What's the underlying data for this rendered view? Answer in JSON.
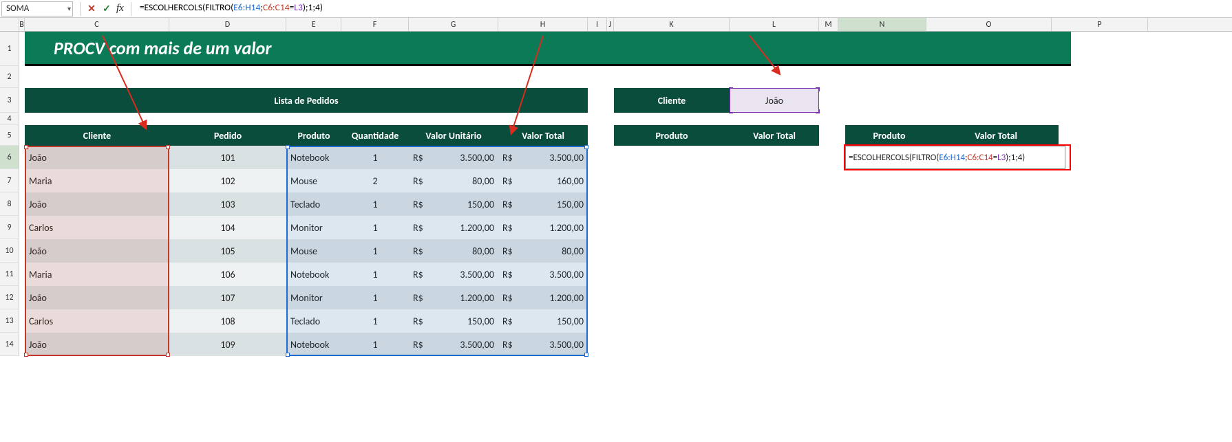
{
  "formula_bar": {
    "name_box": "SOMA",
    "fx_label": "fx",
    "formula_plain": "=ESCOLHERCOLS(FILTRO(E6:H14;C6:C14=L3);1;4)",
    "formula_parts": {
      "a": "=ESCOLHERCOLS(FILTRO(",
      "ref1": "E6:H14",
      "b": ";",
      "ref2": "C6:C14",
      "c": "=",
      "ref3": "L3",
      "d": ");1;4)"
    }
  },
  "columns": [
    "B",
    "C",
    "D",
    "E",
    "F",
    "G",
    "H",
    "I",
    "J",
    "K",
    "L",
    "M",
    "N",
    "O",
    "P"
  ],
  "rows": [
    "1",
    "2",
    "3",
    "4",
    "5",
    "6",
    "7",
    "8",
    "9",
    "10",
    "11",
    "12",
    "13",
    "14"
  ],
  "title": "PROCV com mais de um valor",
  "section_header": "Lista de Pedidos",
  "main_headers": {
    "cliente": "Cliente",
    "pedido": "Pedido",
    "produto": "Produto",
    "quantidade": "Quantidade",
    "valor_unitario": "Valor Unitário",
    "valor_total": "Valor Total"
  },
  "currency_label": "R$",
  "table": [
    {
      "cliente": "João",
      "pedido": "101",
      "produto": "Notebook",
      "quantidade": "1",
      "vu": "3.500,00",
      "vt": "3.500,00"
    },
    {
      "cliente": "Maria",
      "pedido": "102",
      "produto": "Mouse",
      "quantidade": "2",
      "vu": "80,00",
      "vt": "160,00"
    },
    {
      "cliente": "João",
      "pedido": "103",
      "produto": "Teclado",
      "quantidade": "1",
      "vu": "150,00",
      "vt": "150,00"
    },
    {
      "cliente": "Carlos",
      "pedido": "104",
      "produto": "Monitor",
      "quantidade": "1",
      "vu": "1.200,00",
      "vt": "1.200,00"
    },
    {
      "cliente": "João",
      "pedido": "105",
      "produto": "Mouse",
      "quantidade": "1",
      "vu": "80,00",
      "vt": "80,00"
    },
    {
      "cliente": "Maria",
      "pedido": "106",
      "produto": "Notebook",
      "quantidade": "1",
      "vu": "3.500,00",
      "vt": "3.500,00"
    },
    {
      "cliente": "João",
      "pedido": "107",
      "produto": "Monitor",
      "quantidade": "1",
      "vu": "1.200,00",
      "vt": "1.200,00"
    },
    {
      "cliente": "Carlos",
      "pedido": "108",
      "produto": "Teclado",
      "quantidade": "1",
      "vu": "150,00",
      "vt": "150,00"
    },
    {
      "cliente": "João",
      "pedido": "109",
      "produto": "Notebook",
      "quantidade": "1",
      "vu": "3.500,00",
      "vt": "3.500,00"
    }
  ],
  "side": {
    "cliente_label": "Cliente",
    "cliente_value": "João",
    "prod_label": "Produto",
    "vtotal_label": "Valor Total"
  },
  "colors": {
    "brand_green": "#0b7a57",
    "dark_teal": "#0b4d3c",
    "highlight_red": "#c0392b",
    "highlight_blue": "#1f6bd0",
    "highlight_purple": "#7b2fb3"
  }
}
